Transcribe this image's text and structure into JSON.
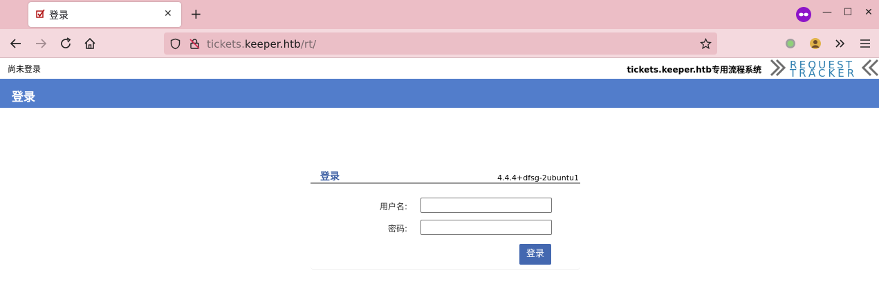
{
  "browser": {
    "tab_title": "登录",
    "new_tab_glyph": "+",
    "close_glyph": "✕",
    "window_controls": {
      "minimize": "—",
      "maximize": "☐",
      "close": "✕"
    },
    "url": {
      "scheme_part": "tickets.",
      "host": "keeper.htb",
      "path": "/rt/"
    }
  },
  "page": {
    "status_text": "尚未登录",
    "site_label": "tickets.keeper.htb专用流程系统",
    "logo": {
      "line1": "REQUEST",
      "line2": "TRACKER",
      "color": "#2f7fb0"
    },
    "header_title": "登录",
    "header_color": "#527dcb"
  },
  "login": {
    "title": "登录",
    "version": "4.4.4+dfsg-2ubuntu1",
    "username_label": "用户名:",
    "password_label": "密码:",
    "username_value": "",
    "password_value": "",
    "submit_label": "登录",
    "button_color": "#4468b0"
  }
}
